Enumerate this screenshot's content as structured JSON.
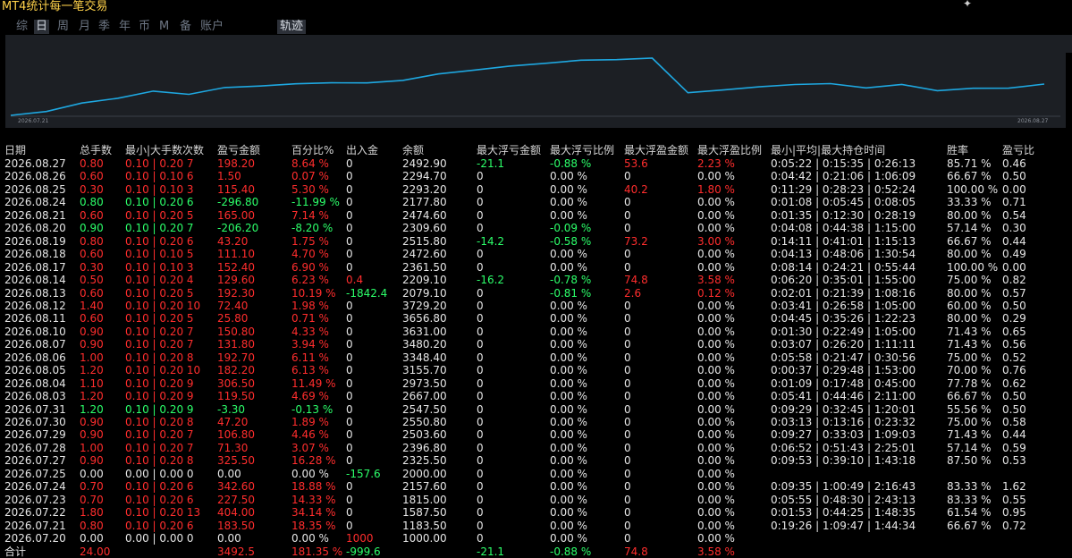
{
  "app": {
    "title": "MT4统计每一笔交易",
    "track_label": "轨迹"
  },
  "tabs": [
    "综",
    "日",
    "周",
    "月",
    "季",
    "年",
    "币",
    "M",
    "备",
    "账户"
  ],
  "active_tab": 1,
  "chart": {
    "x_start": "2026.07.21",
    "x_end": "2026.08.27",
    "line_color": "#1ea7e0",
    "values": [
      1000,
      1183.5,
      1587.5,
      1815,
      2157.6,
      2000,
      2325.5,
      2396.8,
      2503.6,
      2550.8,
      2547.5,
      2667,
      2973.5,
      3155.7,
      3348.4,
      3480.2,
      3631,
      3656.8,
      3729.2,
      2079.1,
      2209.1,
      2361.5,
      2472.6,
      2515.8,
      2309.6,
      2474.6,
      2177.8,
      2293.2,
      2294.7,
      2492.9
    ]
  },
  "colors": {
    "red": "#ff2d2d",
    "green": "#2cff6a",
    "white": "#e6e6e6"
  },
  "headers": [
    "日期",
    "总手数",
    "最小|大手数次数",
    "盈亏金额",
    "百分比%",
    "出入金",
    "余额",
    "最大浮亏金额",
    "最大浮亏比例",
    "最大浮盈金额",
    "最大浮盈比例",
    "最小|平均|最大持仓时间",
    "胜率",
    "盈亏比"
  ],
  "rows": [
    {
      "d": [
        "2026.08.27",
        "0.80",
        "0.10 | 0.20 7",
        "198.20",
        "8.64 %",
        "0",
        "2492.90",
        "-21.1",
        "-0.88 %",
        "53.6",
        "2.23 %",
        "0:05:22 | 0:15:35 | 0:26:13",
        "85.71 %",
        "0.46"
      ],
      "s": "r",
      "fl": "g",
      "fp": "r"
    },
    {
      "d": [
        "2026.08.26",
        "0.60",
        "0.10 | 0.10 6",
        "1.50",
        "0.07 %",
        "0",
        "2294.70",
        "0",
        "0.00 %",
        "0",
        "0.00 %",
        "0:04:42 | 0:21:06 | 1:06:09",
        "66.67 %",
        "0.50"
      ],
      "s": "r"
    },
    {
      "d": [
        "2026.08.25",
        "0.30",
        "0.10 | 0.10 3",
        "115.40",
        "5.30 %",
        "0",
        "2293.20",
        "0",
        "0.00 %",
        "40.2",
        "1.80 %",
        "0:11:29 | 0:28:23 | 0:52:24",
        "100.00 %",
        "0.00"
      ],
      "s": "r",
      "fp": "r"
    },
    {
      "d": [
        "2026.08.24",
        "0.80",
        "0.10 | 0.20 6",
        "-296.80",
        "-11.99 %",
        "0",
        "2177.80",
        "0",
        "0.00 %",
        "0",
        "0.00 %",
        "0:01:08 | 0:05:45 | 0:08:05",
        "33.33 %",
        "0.71"
      ],
      "s": "g"
    },
    {
      "d": [
        "2026.08.21",
        "0.60",
        "0.10 | 0.20 5",
        "165.00",
        "7.14 %",
        "0",
        "2474.60",
        "0",
        "0.00 %",
        "0",
        "0.00 %",
        "0:01:35 | 0:12:30 | 0:28:19",
        "80.00 %",
        "0.54"
      ],
      "s": "r"
    },
    {
      "d": [
        "2026.08.20",
        "0.90",
        "0.10 | 0.20 7",
        "-206.20",
        "-8.20 %",
        "0",
        "2309.60",
        "0",
        "-0.09 %",
        "0",
        "0.00 %",
        "0:04:08 | 0:44:38 | 1:15:00",
        "57.14 %",
        "0.30"
      ],
      "s": "g",
      "fl": "g2"
    },
    {
      "d": [
        "2026.08.19",
        "0.80",
        "0.10 | 0.20 6",
        "43.20",
        "1.75 %",
        "0",
        "2515.80",
        "-14.2",
        "-0.58 %",
        "73.2",
        "3.00 %",
        "0:14:11 | 0:41:01 | 1:15:13",
        "66.67 %",
        "0.44"
      ],
      "s": "r",
      "fl": "g",
      "fp": "r"
    },
    {
      "d": [
        "2026.08.18",
        "0.60",
        "0.10 | 0.10 5",
        "111.10",
        "4.70 %",
        "0",
        "2472.60",
        "0",
        "0.00 %",
        "0",
        "0.00 %",
        "0:04:13 | 0:48:06 | 1:30:54",
        "80.00 %",
        "0.49"
      ],
      "s": "r"
    },
    {
      "d": [
        "2026.08.17",
        "0.30",
        "0.10 | 0.10 3",
        "152.40",
        "6.90 %",
        "0",
        "2361.50",
        "0",
        "0.00 %",
        "0",
        "0.00 %",
        "0:08:14 | 0:24:21 | 0:55:44",
        "100.00 %",
        "0.00"
      ],
      "s": "r"
    },
    {
      "d": [
        "2026.08.14",
        "0.50",
        "0.10 | 0.20 4",
        "129.60",
        "6.23 %",
        "0.4",
        "2209.10",
        "-16.2",
        "-0.78 %",
        "74.8",
        "3.58 %",
        "0:06:20 | 0:35:01 | 1:55:00",
        "75.00 %",
        "0.82"
      ],
      "s": "r",
      "io": "r",
      "fl": "g",
      "fp": "r"
    },
    {
      "d": [
        "2026.08.13",
        "0.60",
        "0.10 | 0.20 5",
        "192.30",
        "10.19 %",
        "-1842.4",
        "2079.10",
        "0",
        "-0.81 %",
        "2.6",
        "0.12 %",
        "0:02:01 | 0:21:39 | 1:08:16",
        "80.00 %",
        "0.57"
      ],
      "s": "r",
      "io": "g",
      "fl": "g2",
      "fp": "r"
    },
    {
      "d": [
        "2026.08.12",
        "1.40",
        "0.10 | 0.20 10",
        "72.40",
        "1.98 %",
        "0",
        "3729.20",
        "0",
        "0.00 %",
        "0",
        "0.00 %",
        "0:03:41 | 0:26:58 | 1:05:00",
        "60.00 %",
        "0.50"
      ],
      "s": "r"
    },
    {
      "d": [
        "2026.08.11",
        "0.60",
        "0.10 | 0.20 5",
        "25.80",
        "0.71 %",
        "0",
        "3656.80",
        "0",
        "0.00 %",
        "0",
        "0.00 %",
        "0:04:45 | 0:35:26 | 1:22:23",
        "80.00 %",
        "0.29"
      ],
      "s": "r"
    },
    {
      "d": [
        "2026.08.10",
        "0.90",
        "0.10 | 0.20 7",
        "150.80",
        "4.33 %",
        "0",
        "3631.00",
        "0",
        "0.00 %",
        "0",
        "0.00 %",
        "0:01:30 | 0:22:49 | 1:05:00",
        "71.43 %",
        "0.65"
      ],
      "s": "r"
    },
    {
      "d": [
        "2026.08.07",
        "0.90",
        "0.10 | 0.20 7",
        "131.80",
        "3.94 %",
        "0",
        "3480.20",
        "0",
        "0.00 %",
        "0",
        "0.00 %",
        "0:03:07 | 0:26:20 | 1:11:11",
        "71.43 %",
        "0.56"
      ],
      "s": "r"
    },
    {
      "d": [
        "2026.08.06",
        "1.00",
        "0.10 | 0.20 8",
        "192.70",
        "6.11 %",
        "0",
        "3348.40",
        "0",
        "0.00 %",
        "0",
        "0.00 %",
        "0:05:58 | 0:21:47 | 0:30:56",
        "75.00 %",
        "0.52"
      ],
      "s": "r"
    },
    {
      "d": [
        "2026.08.05",
        "1.20",
        "0.10 | 0.20 10",
        "182.20",
        "6.13 %",
        "0",
        "3155.70",
        "0",
        "0.00 %",
        "0",
        "0.00 %",
        "0:00:37 | 0:29:48 | 1:53:00",
        "70.00 %",
        "0.76"
      ],
      "s": "r"
    },
    {
      "d": [
        "2026.08.04",
        "1.10",
        "0.10 | 0.20 9",
        "306.50",
        "11.49 %",
        "0",
        "2973.50",
        "0",
        "0.00 %",
        "0",
        "0.00 %",
        "0:01:09 | 0:17:48 | 0:45:00",
        "77.78 %",
        "0.62"
      ],
      "s": "r"
    },
    {
      "d": [
        "2026.08.03",
        "1.20",
        "0.10 | 0.20 9",
        "119.50",
        "4.69 %",
        "0",
        "2667.00",
        "0",
        "0.00 %",
        "0",
        "0.00 %",
        "0:05:41 | 0:44:46 | 2:11:00",
        "66.67 %",
        "0.50"
      ],
      "s": "r"
    },
    {
      "d": [
        "2026.07.31",
        "1.20",
        "0.10 | 0.20 9",
        "-3.30",
        "-0.13 %",
        "0",
        "2547.50",
        "0",
        "0.00 %",
        "0",
        "0.00 %",
        "0:09:29 | 0:32:45 | 1:20:01",
        "55.56 %",
        "0.50"
      ],
      "s": "g"
    },
    {
      "d": [
        "2026.07.30",
        "0.90",
        "0.10 | 0.20 8",
        "47.20",
        "1.89 %",
        "0",
        "2550.80",
        "0",
        "0.00 %",
        "0",
        "0.00 %",
        "0:03:13 | 0:13:16 | 0:23:32",
        "75.00 %",
        "0.58"
      ],
      "s": "r"
    },
    {
      "d": [
        "2026.07.29",
        "0.90",
        "0.10 | 0.20 7",
        "106.80",
        "4.46 %",
        "0",
        "2503.60",
        "0",
        "0.00 %",
        "0",
        "0.00 %",
        "0:09:27 | 0:33:03 | 1:09:03",
        "71.43 %",
        "0.44"
      ],
      "s": "r"
    },
    {
      "d": [
        "2026.07.28",
        "1.00",
        "0.10 | 0.20 7",
        "71.30",
        "3.07 %",
        "0",
        "2396.80",
        "0",
        "0.00 %",
        "0",
        "0.00 %",
        "0:06:52 | 0:51:43 | 2:25:01",
        "57.14 %",
        "0.59"
      ],
      "s": "r"
    },
    {
      "d": [
        "2026.07.27",
        "0.90",
        "0.10 | 0.20 8",
        "325.50",
        "16.28 %",
        "0",
        "2325.50",
        "0",
        "0.00 %",
        "0",
        "0.00 %",
        "0:09:53 | 0:39:10 | 1:43:18",
        "87.50 %",
        "0.53"
      ],
      "s": "r"
    },
    {
      "d": [
        "2026.07.25",
        "0.00",
        "0.00 | 0.00 0",
        "0.00",
        "0.00 %",
        "-157.6",
        "2000.00",
        "0",
        "0.00 %",
        "0",
        "0.00 %",
        "",
        "",
        ""
      ],
      "s": "w",
      "io": "g"
    },
    {
      "d": [
        "2026.07.24",
        "0.70",
        "0.10 | 0.20 6",
        "342.60",
        "18.88 %",
        "0",
        "2157.60",
        "0",
        "0.00 %",
        "0",
        "0.00 %",
        "0:09:35 | 1:00:49 | 2:16:43",
        "83.33 %",
        "1.62"
      ],
      "s": "r"
    },
    {
      "d": [
        "2026.07.23",
        "0.70",
        "0.10 | 0.20 6",
        "227.50",
        "14.33 %",
        "0",
        "1815.00",
        "0",
        "0.00 %",
        "0",
        "0.00 %",
        "0:05:55 | 0:48:30 | 2:43:13",
        "83.33 %",
        "0.55"
      ],
      "s": "r"
    },
    {
      "d": [
        "2026.07.22",
        "1.80",
        "0.10 | 0.20 13",
        "404.00",
        "34.14 %",
        "0",
        "1587.50",
        "0",
        "0.00 %",
        "0",
        "0.00 %",
        "0:01:53 | 0:44:25 | 1:48:35",
        "61.54 %",
        "0.95"
      ],
      "s": "r"
    },
    {
      "d": [
        "2026.07.21",
        "0.80",
        "0.10 | 0.20 6",
        "183.50",
        "18.35 %",
        "0",
        "1183.50",
        "0",
        "0.00 %",
        "0",
        "0.00 %",
        "0:19:26 | 1:09:47 | 1:44:34",
        "66.67 %",
        "0.72"
      ],
      "s": "r"
    },
    {
      "d": [
        "2026.07.20",
        "0.00",
        "0.00 | 0.00 0",
        "0.00",
        "0.00 %",
        "1000",
        "1000.00",
        "0",
        "0.00 %",
        "0",
        "0.00 %",
        "",
        "",
        ""
      ],
      "s": "w",
      "io": "r"
    },
    {
      "d": [
        "合计",
        "24.00",
        "",
        "3492.5",
        "181.35 %",
        "-999.6",
        "",
        "-21.1",
        "-0.88 %",
        "74.8",
        "3.58 %",
        "",
        "",
        ""
      ],
      "s": "r",
      "io": "g",
      "fl": "g",
      "fp": "r"
    }
  ]
}
